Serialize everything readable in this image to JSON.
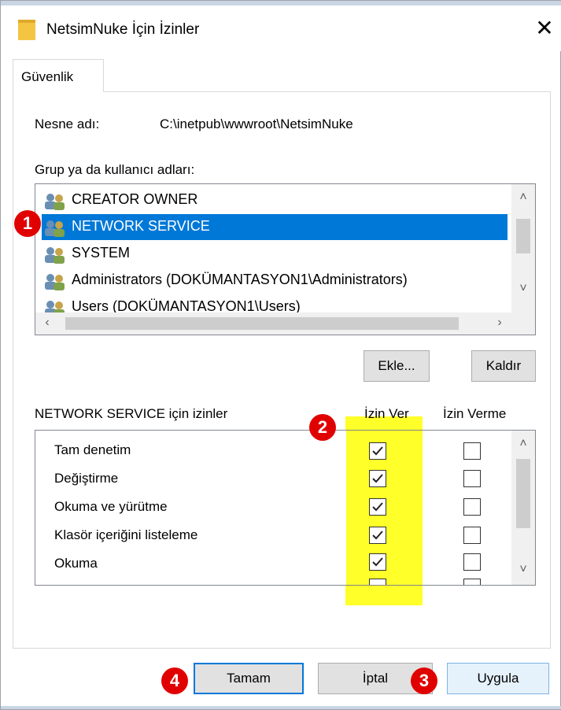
{
  "window": {
    "title": "NetsimNuke İçin İzinler",
    "close_label": "✕"
  },
  "tab": {
    "label": "Güvenlik"
  },
  "object": {
    "label": "Nesne adı:",
    "value": "C:\\inetpub\\wwwroot\\NetsimNuke"
  },
  "groups": {
    "label": "Grup ya da kullanıcı adları:",
    "items": [
      {
        "name": "CREATOR OWNER",
        "selected": false
      },
      {
        "name": "NETWORK SERVICE",
        "selected": true
      },
      {
        "name": "SYSTEM",
        "selected": false
      },
      {
        "name": "Administrators (DOKÜMANTASYON1\\Administrators)",
        "selected": false
      },
      {
        "name": "Users (DOKÜMANTASYON1\\Users)",
        "selected": false
      }
    ],
    "add_label": "Ekle...",
    "remove_label": "Kaldır"
  },
  "permissions": {
    "label": "NETWORK SERVICE için izinler",
    "allow_header": "İzin Ver",
    "deny_header": "İzin Verme",
    "items": [
      {
        "name": "Tam denetim",
        "allow": true,
        "deny": false
      },
      {
        "name": "Değiştirme",
        "allow": true,
        "deny": false
      },
      {
        "name": "Okuma ve yürütme",
        "allow": true,
        "deny": false
      },
      {
        "name": "Klasör içeriğini listeleme",
        "allow": true,
        "deny": false
      },
      {
        "name": "Okuma",
        "allow": true,
        "deny": false
      }
    ]
  },
  "footer": {
    "ok_label": "Tamam",
    "cancel_label": "İptal",
    "apply_label": "Uygula"
  },
  "markers": [
    "1",
    "2",
    "3",
    "4"
  ],
  "colors": {
    "selection": "#0078d7",
    "highlight": "#ffff29",
    "marker": "#e10000"
  }
}
